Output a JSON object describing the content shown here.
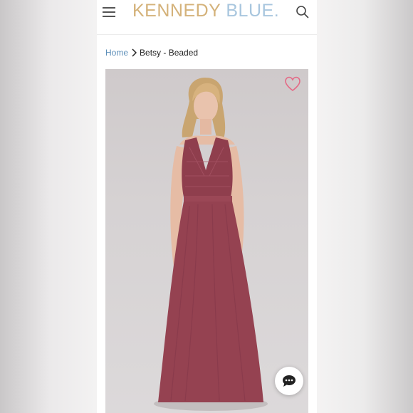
{
  "header": {
    "logo_primary": "KENNEDY",
    "logo_secondary": "BLUE",
    "logo_dot": ".",
    "icons": {
      "menu": "hamburger-menu-icon",
      "search": "search-icon"
    }
  },
  "breadcrumb": {
    "home": "Home",
    "separator_icon": "chevron-right-icon",
    "current": "Betsy - Beaded"
  },
  "product": {
    "image_subject": "model wearing burgundy beaded v-neck gown",
    "wishlist_icon": "heart-outline-icon"
  },
  "chat": {
    "icon": "chat-bubble-icon"
  },
  "colors": {
    "logo_gold": "#d4b27a",
    "logo_blue": "#a8c6de",
    "link_blue": "#5d8fb9",
    "heart_pink": "#e46a86",
    "dress_burgundy": "#954251"
  }
}
